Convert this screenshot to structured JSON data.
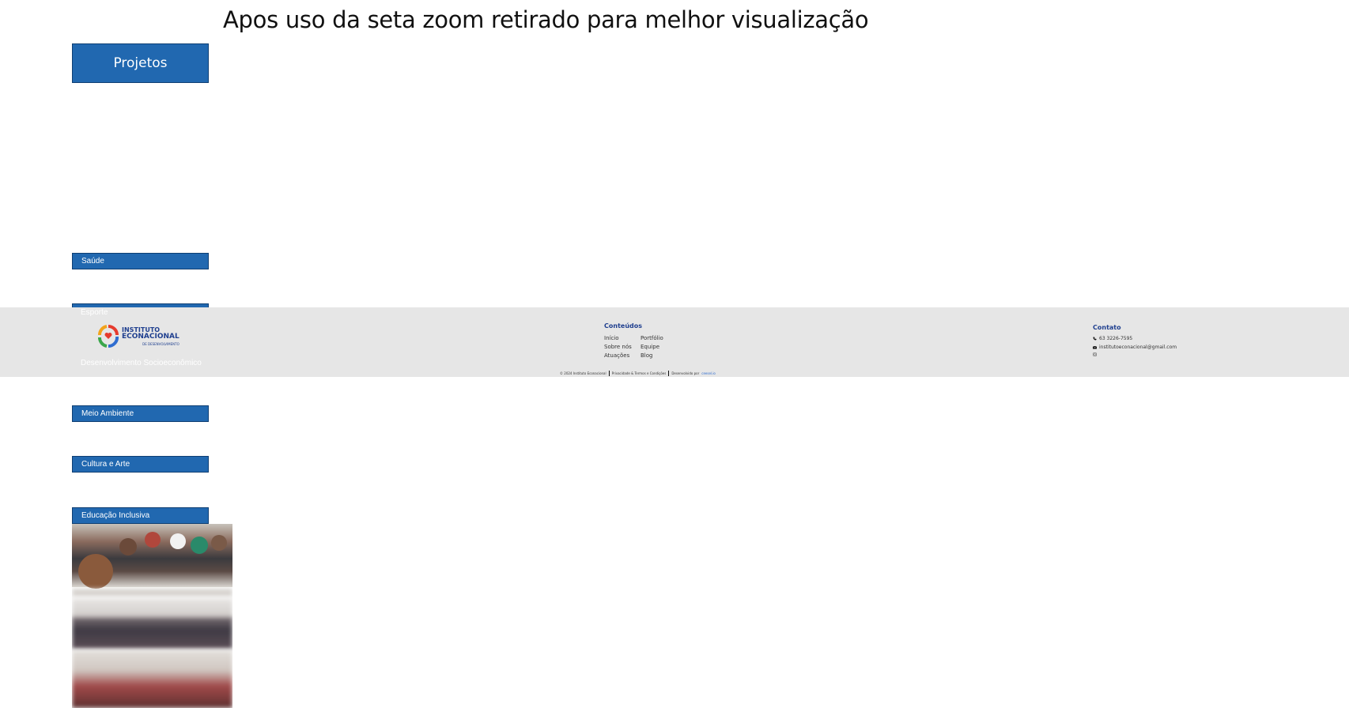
{
  "annotation": "Apos uso da seta zoom retirado para melhor visualização",
  "projects_button": "Projetos",
  "categories": [
    "Saúde",
    "Esporte",
    "Desenvolvimento Socioeconômico",
    "Meio Ambiente",
    "Cultura e Arte",
    "Educação Inclusiva"
  ],
  "footer": {
    "logo": {
      "line1": "INSTITUTO",
      "line2": "ECONACIONAL",
      "line3": "DE DESENVOLVIMENTO"
    },
    "contents_title": "Conteúdos",
    "links": [
      "Início",
      "Portfólio",
      "Sobre nós",
      "Equipe",
      "Atuações",
      "Blog"
    ],
    "contact_title": "Contato",
    "phone": "63 3226-7595",
    "email": "institutoeconacional@gmail.com",
    "copyright": "© 2024 Instituto Econacional",
    "privacy": "Privacidade & Termos e Condições",
    "developed_by": "Desenvolvido por",
    "developer": "ceesel.io"
  },
  "colors": {
    "button_blue": "#2168b0",
    "footer_bg": "#e6e6e6",
    "brand_navy": "#1f3f8f"
  }
}
